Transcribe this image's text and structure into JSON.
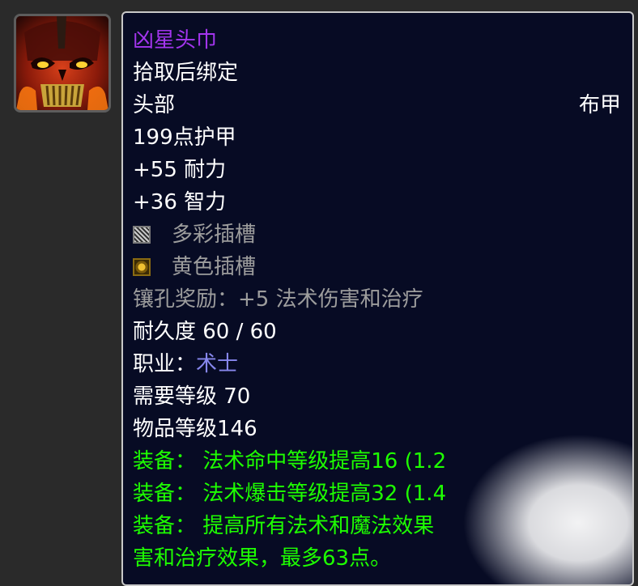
{
  "icon": {
    "name": "skull-helm-icon"
  },
  "tooltip": {
    "item_name": "凶星头巾",
    "binding": "拾取后绑定",
    "slot": "头部",
    "armor_type": "布甲",
    "armor": "199点护甲",
    "stamina": "+55 耐力",
    "intellect": "+36 智力",
    "socket_meta": "多彩插槽",
    "socket_yellow": "黄色插槽",
    "socket_bonus": "镶孔奖励：+5 法术伤害和治疗",
    "durability": "耐久度 60 / 60",
    "class_label": "职业：",
    "class_value": "术士",
    "req_level": "需要等级 70",
    "item_level": "物品等级146",
    "equip1": "装备：  法术命中等级提高16 (1.2",
    "equip2": "装备：  法术爆击等级提高32 (1.4",
    "equip3": "装备：  提高所有法术和魔法效果",
    "equip3_cont": "害和治疗效果，最多63点。"
  },
  "colors": {
    "epic": "#a335ee",
    "green": "#1eff00",
    "grey": "#9d9d9d",
    "class": "#8787ed",
    "bg": "#070b24"
  }
}
